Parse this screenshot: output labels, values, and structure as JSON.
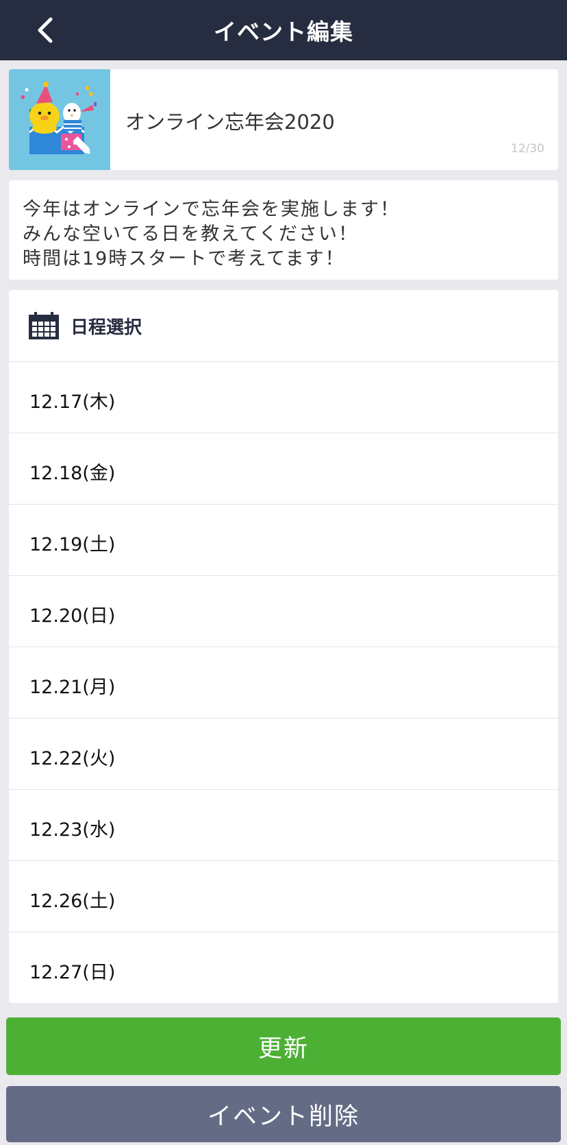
{
  "header": {
    "title": "イベント編集",
    "back_icon": "chevron-left-icon"
  },
  "event": {
    "thumbnail_icon": "party-characters-image",
    "title": "オンライン忘年会2020",
    "char_count": "12/30"
  },
  "description": {
    "lines": [
      "今年はオンラインで忘年会を実施します！",
      "みんな空いてる日を教えてください！",
      "時間は19時スタートで考えてます！"
    ]
  },
  "schedule": {
    "icon": "calendar-icon",
    "title": "日程選択",
    "dates": [
      "12.17(木)",
      "12.18(金)",
      "12.19(土)",
      "12.20(日)",
      "12.21(月)",
      "12.22(火)",
      "12.23(水)",
      "12.26(土)",
      "12.27(日)"
    ]
  },
  "buttons": {
    "update": "更新",
    "delete": "イベント削除"
  },
  "colors": {
    "header_bg": "#272d40",
    "update_green": "#4cb035",
    "delete_gray": "#646c85"
  }
}
